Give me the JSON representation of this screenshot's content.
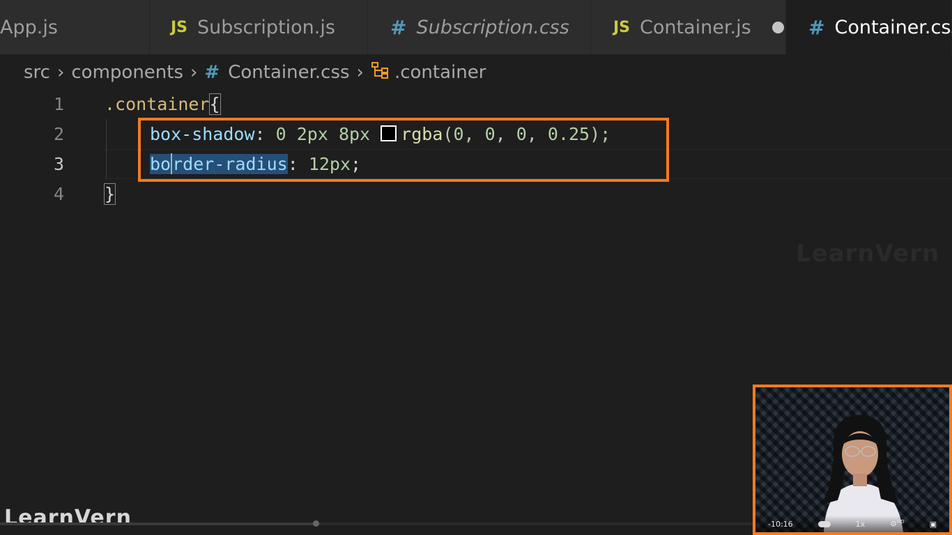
{
  "tabs": [
    {
      "label": "App.js",
      "type": "js",
      "icon": "",
      "active": false
    },
    {
      "label": "Subscription.js",
      "type": "js",
      "icon": "JS",
      "active": false
    },
    {
      "label": "Subscription.css",
      "type": "css",
      "icon": "#",
      "active": false
    },
    {
      "label": "Container.js",
      "type": "js",
      "icon": "JS",
      "active": false,
      "modified": true
    },
    {
      "label": "Container.css",
      "type": "css",
      "icon": "#",
      "active": true
    }
  ],
  "breadcrumb": {
    "folder1": "src",
    "folder2": "components",
    "file_icon": "#",
    "file": "Container.css",
    "symbol": ".container"
  },
  "editor": {
    "line_numbers": [
      "1",
      "2",
      "3",
      "4"
    ],
    "active_line": "3",
    "line1": {
      "selector": ".container",
      "brace": "{"
    },
    "line2": {
      "property": "box-shadow",
      "colon": ":",
      "values": "0 2px 8px",
      "fn": "rgba",
      "args": "(0, 0, 0, 0.25);"
    },
    "line3": {
      "prop_a": "bo",
      "prop_b": "rder-radius",
      "colon": ":",
      "value": "12px",
      "semi": ";"
    },
    "line4": {
      "brace": "}"
    }
  },
  "watermark": {
    "center": "LearnVern",
    "corner": "LearnVern"
  },
  "video": {
    "time": "-10:16",
    "speed": "1x",
    "quality": "HD",
    "progress_fraction": 0.42
  },
  "colors": {
    "highlight_box": "#f47b20",
    "selection": "#264f78"
  }
}
